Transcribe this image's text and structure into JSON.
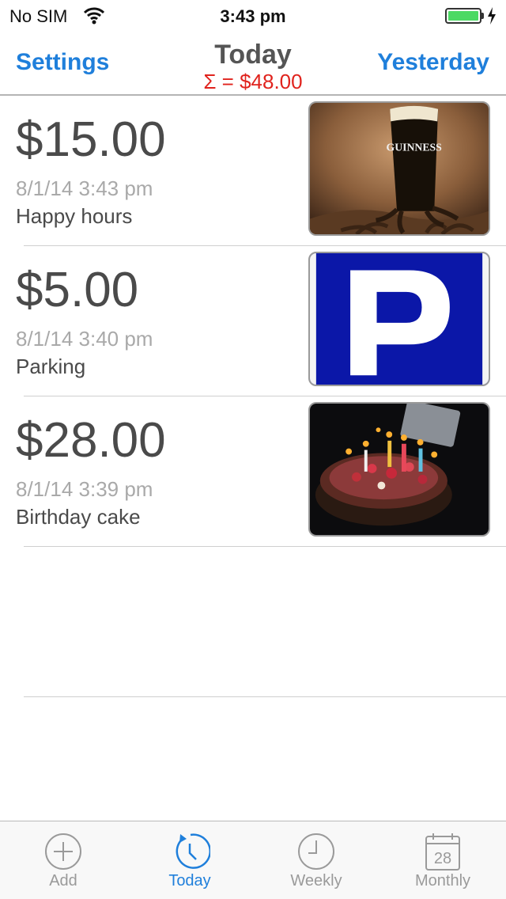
{
  "status_bar": {
    "carrier": "No SIM",
    "time": "3:43 pm"
  },
  "navbar": {
    "left_button": "Settings",
    "title": "Today",
    "total": "Σ = $48.00",
    "right_button": "Yesterday"
  },
  "expenses": [
    {
      "amount": "$15.00",
      "date": "8/1/14 3:43 pm",
      "description": "Happy hours",
      "image": "guinness-photo"
    },
    {
      "amount": "$5.00",
      "date": "8/1/14 3:40 pm",
      "description": "Parking",
      "image": "parking-sign"
    },
    {
      "amount": "$28.00",
      "date": "8/1/14 3:39 pm",
      "description": "Birthday cake",
      "image": "birthday-cake-photo"
    }
  ],
  "beer_label": "GUINNESS",
  "tabs": [
    {
      "label": "Add",
      "icon": "plus-circle-icon",
      "active": false
    },
    {
      "label": "Today",
      "icon": "clock-rewind-icon",
      "active": true
    },
    {
      "label": "Weekly",
      "icon": "clock-icon",
      "active": false
    },
    {
      "label": "Monthly",
      "icon": "calendar-icon",
      "active": false
    }
  ],
  "calendar_day": "28",
  "colors": {
    "accent": "#1f7fdb",
    "total": "#e0231d",
    "battery": "#4cd964"
  }
}
